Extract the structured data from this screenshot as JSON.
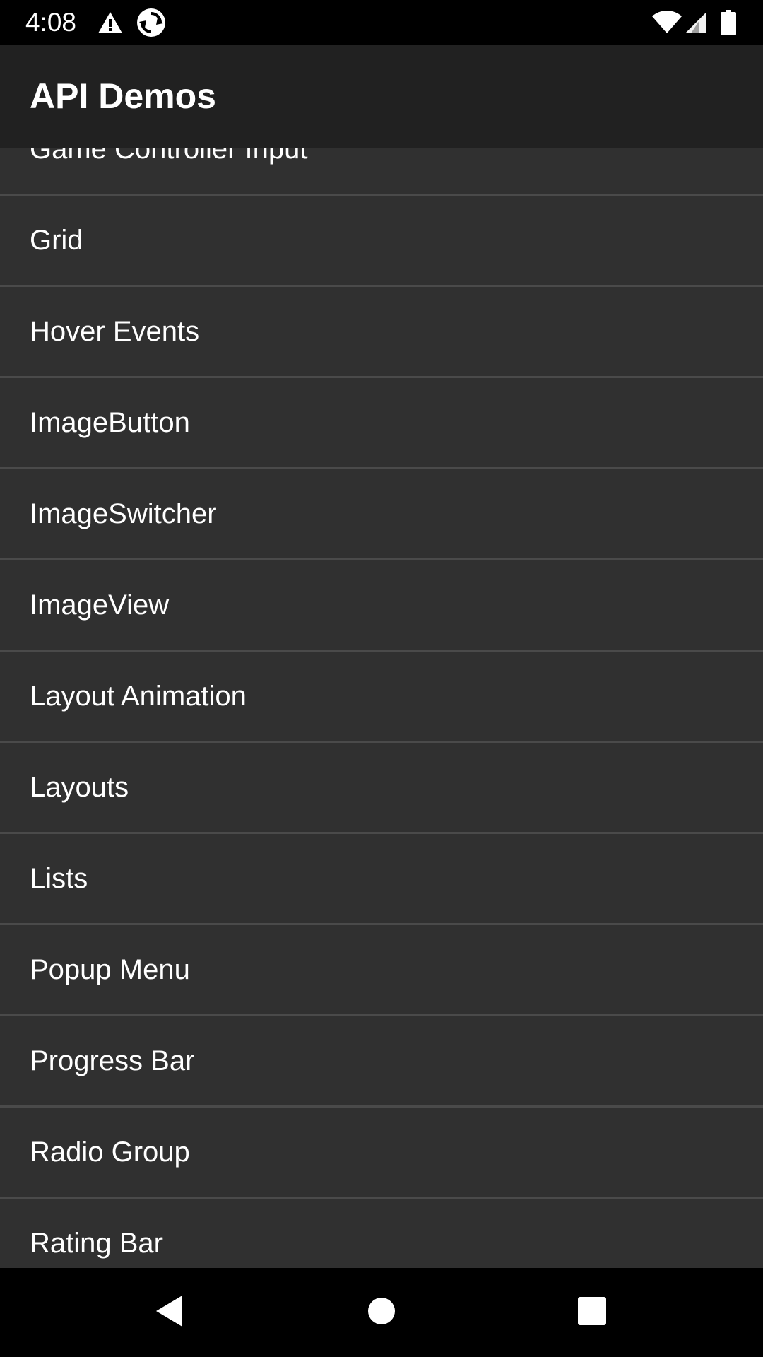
{
  "status_bar": {
    "time": "4:08",
    "left_icons": [
      "warning-icon",
      "sync-icon"
    ],
    "right_icons": [
      "wifi-icon",
      "cell-signal-icon",
      "battery-icon"
    ]
  },
  "app_bar": {
    "title": "API Demos"
  },
  "list": {
    "items": [
      {
        "label": "Game Controller Input"
      },
      {
        "label": "Grid"
      },
      {
        "label": "Hover Events"
      },
      {
        "label": "ImageButton"
      },
      {
        "label": "ImageSwitcher"
      },
      {
        "label": "ImageView"
      },
      {
        "label": "Layout Animation"
      },
      {
        "label": "Layouts"
      },
      {
        "label": "Lists"
      },
      {
        "label": "Popup Menu"
      },
      {
        "label": "Progress Bar"
      },
      {
        "label": "Radio Group"
      },
      {
        "label": "Rating Bar"
      }
    ]
  },
  "nav_bar": {
    "buttons": [
      "back-icon",
      "home-icon",
      "recents-icon"
    ]
  },
  "colors": {
    "status_bar_bg": "#000000",
    "app_bar_bg": "#212121",
    "list_bg": "#303030",
    "divider": "#4a4a4a",
    "text": "#ffffff"
  }
}
